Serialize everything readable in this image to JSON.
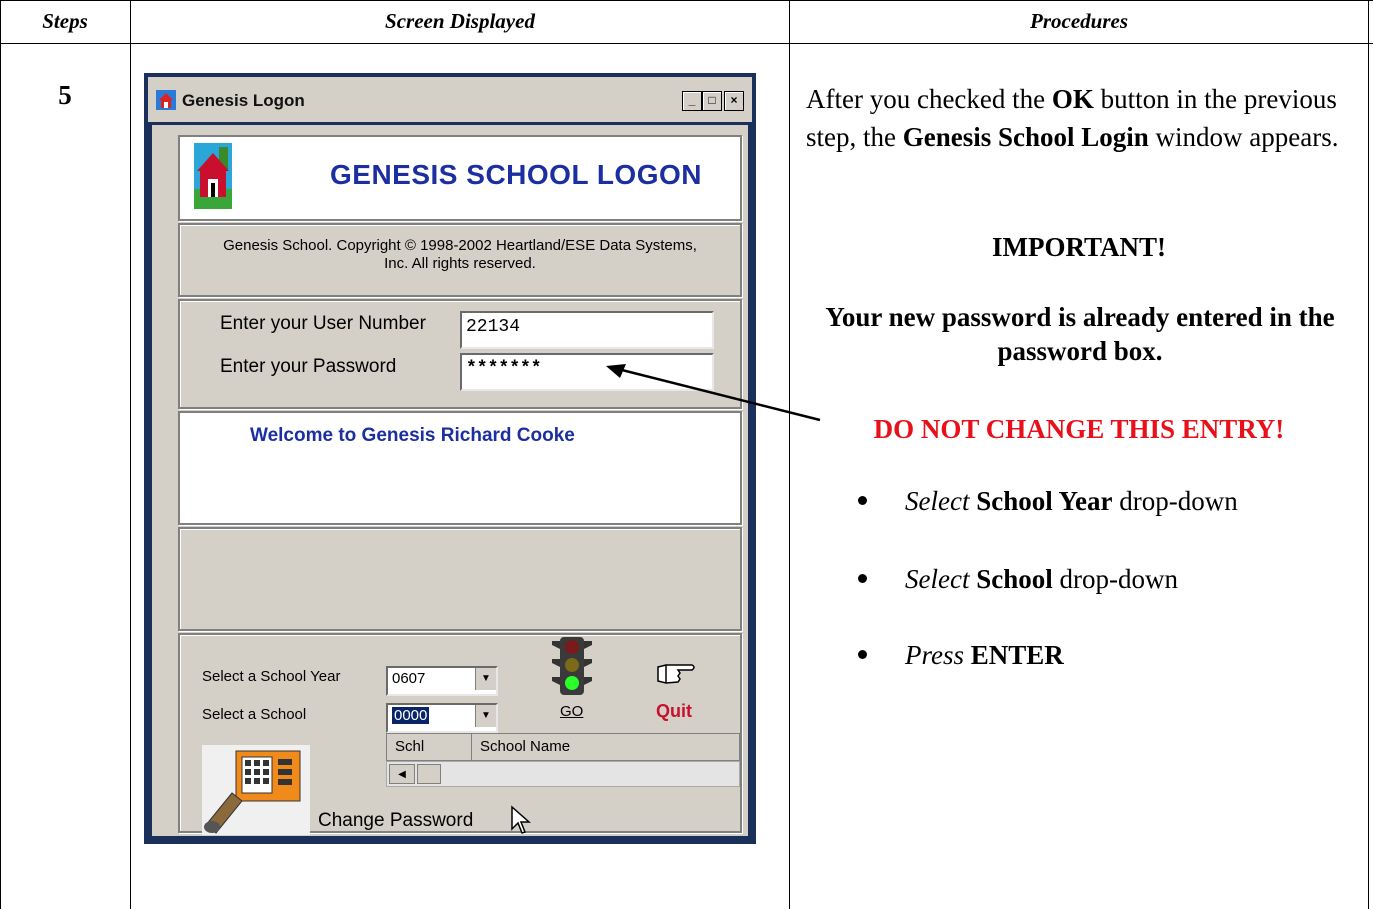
{
  "table": {
    "headers": [
      "Steps",
      "Screen Displayed",
      "Procedures"
    ],
    "step_number": "5"
  },
  "window": {
    "title": "Genesis Logon",
    "banner_title": "GENESIS SCHOOL LOGON",
    "copyright": "Genesis School.  Copyright © 1998-2002 Heartland/ESE Data Systems, Inc.   All rights reserved.",
    "user_number_label": "Enter your User Number",
    "user_number_value": "22134",
    "password_label": "Enter your Password",
    "password_value": "*******",
    "welcome": "Welcome to Genesis Richard Cooke",
    "school_year_label": "Select a School Year",
    "school_year_value": "0607",
    "school_label": "Select a School",
    "school_value": "0000",
    "go_label": "GO",
    "quit_label": "Quit",
    "list_col_schl": "Schl",
    "list_col_name": "School Name",
    "change_password": "Change Password",
    "icons": [
      "house-icon",
      "traffic-light-icon",
      "pointing-hand-icon",
      "keypad-icon",
      "mouse-cursor-icon"
    ]
  },
  "procedures": {
    "p1_a": "After you checked the ",
    "p1_ok": "OK",
    "p1_b": "  button in the previous step, the ",
    "p1_login": "Genesis School Login",
    "p1_c": " window appears.",
    "important": "IMPORTANT!",
    "password_note": "Your new password is already entered in the password box.",
    "warning": "DO NOT CHANGE THIS ENTRY!",
    "warning_color": "#e8101a",
    "b1_verb": "Select",
    "b1_bold": "School Year",
    "b1_rest": " drop-down",
    "b2_verb": "Select",
    "b2_bold": "School",
    "b2_rest": " drop-down",
    "b3_verb": "Press",
    "b3_bold": "ENTER"
  }
}
